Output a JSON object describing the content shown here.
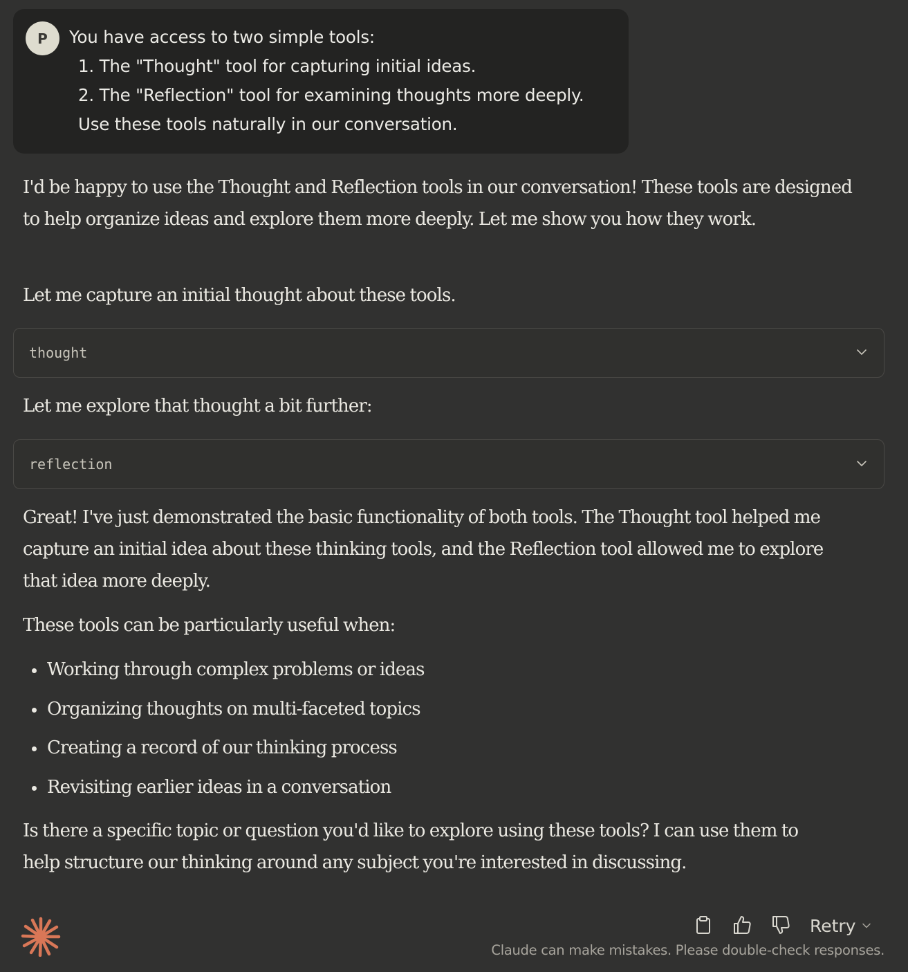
{
  "user_message": {
    "avatar_letter": "P",
    "lines": [
      "You have access to two simple tools:",
      "1. The \"Thought\" tool for capturing initial ideas.",
      "2. The \"Reflection\" tool for examining thoughts more deeply.",
      "Use these tools naturally in our conversation."
    ]
  },
  "assistant": {
    "intro": "I'd be happy to use the Thought and Reflection tools in our conversation! These tools are designed to help organize ideas and explore them more deeply. Let me show you how they work.",
    "capture_line": "Let me capture an initial thought about these tools.",
    "tool_1_label": "thought",
    "explore_line": "Let me explore that thought a bit further:",
    "tool_2_label": "reflection",
    "great_paragraph": "Great! I've just demonstrated the basic functionality of both tools. The Thought tool helped me capture an initial idea about these thinking tools, and the Reflection tool allowed me to explore that idea more deeply.",
    "useful_intro": "These tools can be particularly useful when:",
    "bullets": [
      "Working through complex problems or ideas",
      "Organizing thoughts on multi-faceted topics",
      "Creating a record of our thinking process",
      "Revisiting earlier ideas in a conversation"
    ],
    "closing": "Is there a specific topic or question you'd like to explore using these tools? I can use them to help structure our thinking around any subject you're interested in discussing."
  },
  "footer": {
    "retry_label": "Retry",
    "disclaimer": "Claude can make mistakes. Please double-check responses."
  },
  "colors": {
    "background": "#313130",
    "user_bubble": "#232322",
    "accent_logo": "#d97757"
  },
  "icons": {
    "logo": "claude-spark-icon",
    "copy": "clipboard-icon",
    "like": "thumbs-up-icon",
    "dislike": "thumbs-down-icon",
    "retry_dropdown": "chevron-down-icon",
    "tool_expand": "chevron-down-icon"
  }
}
